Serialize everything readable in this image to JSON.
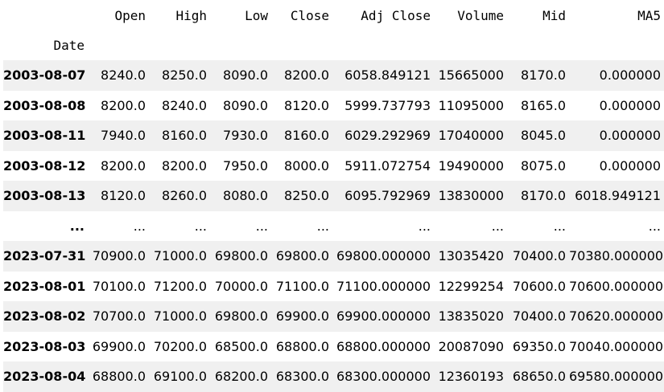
{
  "dataframe": {
    "columns": [
      "Open",
      "High",
      "Low",
      "Close",
      "Adj Close",
      "Volume",
      "Mid",
      "MA5"
    ],
    "index_name": "Date",
    "rows": [
      {
        "date": "2003-08-07",
        "values": [
          "8240.0",
          "8250.0",
          "8090.0",
          "8200.0",
          "6058.849121",
          "15665000",
          "8170.0",
          "0.000000"
        ]
      },
      {
        "date": "2003-08-08",
        "values": [
          "8200.0",
          "8240.0",
          "8090.0",
          "8120.0",
          "5999.737793",
          "11095000",
          "8165.0",
          "0.000000"
        ]
      },
      {
        "date": "2003-08-11",
        "values": [
          "7940.0",
          "8160.0",
          "7930.0",
          "8160.0",
          "6029.292969",
          "17040000",
          "8045.0",
          "0.000000"
        ]
      },
      {
        "date": "2003-08-12",
        "values": [
          "8200.0",
          "8200.0",
          "7950.0",
          "8000.0",
          "5911.072754",
          "19490000",
          "8075.0",
          "0.000000"
        ]
      },
      {
        "date": "2003-08-13",
        "values": [
          "8120.0",
          "8260.0",
          "8080.0",
          "8250.0",
          "6095.792969",
          "13830000",
          "8170.0",
          "6018.949121"
        ]
      },
      {
        "date": "...",
        "values": [
          "...",
          "...",
          "...",
          "...",
          "...",
          "...",
          "...",
          "..."
        ]
      },
      {
        "date": "2023-07-31",
        "values": [
          "70900.0",
          "71000.0",
          "69800.0",
          "69800.0",
          "69800.000000",
          "13035420",
          "70400.0",
          "70380.000000"
        ]
      },
      {
        "date": "2023-08-01",
        "values": [
          "70100.0",
          "71200.0",
          "70000.0",
          "71100.0",
          "71100.000000",
          "12299254",
          "70600.0",
          "70600.000000"
        ]
      },
      {
        "date": "2023-08-02",
        "values": [
          "70700.0",
          "71000.0",
          "69800.0",
          "69900.0",
          "69900.000000",
          "13835020",
          "70400.0",
          "70620.000000"
        ]
      },
      {
        "date": "2023-08-03",
        "values": [
          "69900.0",
          "70200.0",
          "68500.0",
          "68800.0",
          "68800.000000",
          "20087090",
          "69350.0",
          "70040.000000"
        ]
      },
      {
        "date": "2023-08-04",
        "values": [
          "68800.0",
          "69100.0",
          "68200.0",
          "68300.0",
          "68300.000000",
          "12360193",
          "68650.0",
          "69580.000000"
        ]
      }
    ]
  },
  "colors": {
    "stripe": "#f0f0f0",
    "background": "#ffffff",
    "text": "#000000"
  }
}
